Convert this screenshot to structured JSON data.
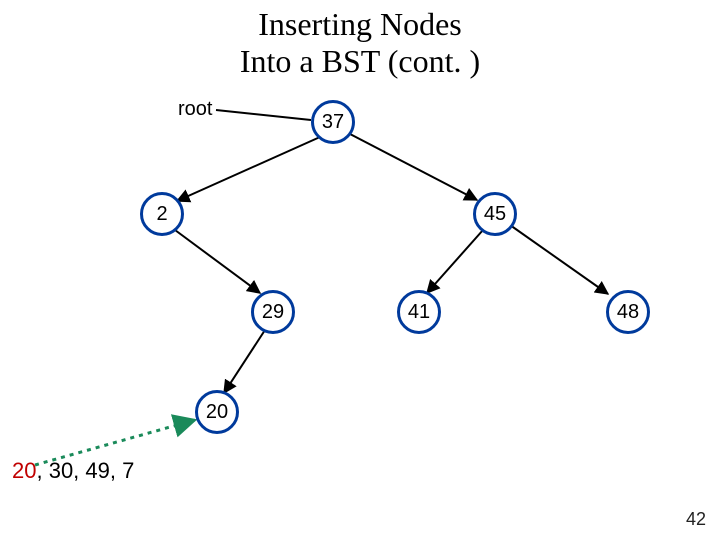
{
  "title": {
    "line1": "Inserting Nodes",
    "line2": "Into a BST (cont. )"
  },
  "labels": {
    "root": "root"
  },
  "nodes": {
    "n37": "37",
    "n2": "2",
    "n45": "45",
    "n29": "29",
    "n41": "41",
    "n48": "48",
    "n20": "20"
  },
  "sequence": {
    "highlight": "20",
    "rest": ", 30, 49, 7"
  },
  "page_number": "42"
}
